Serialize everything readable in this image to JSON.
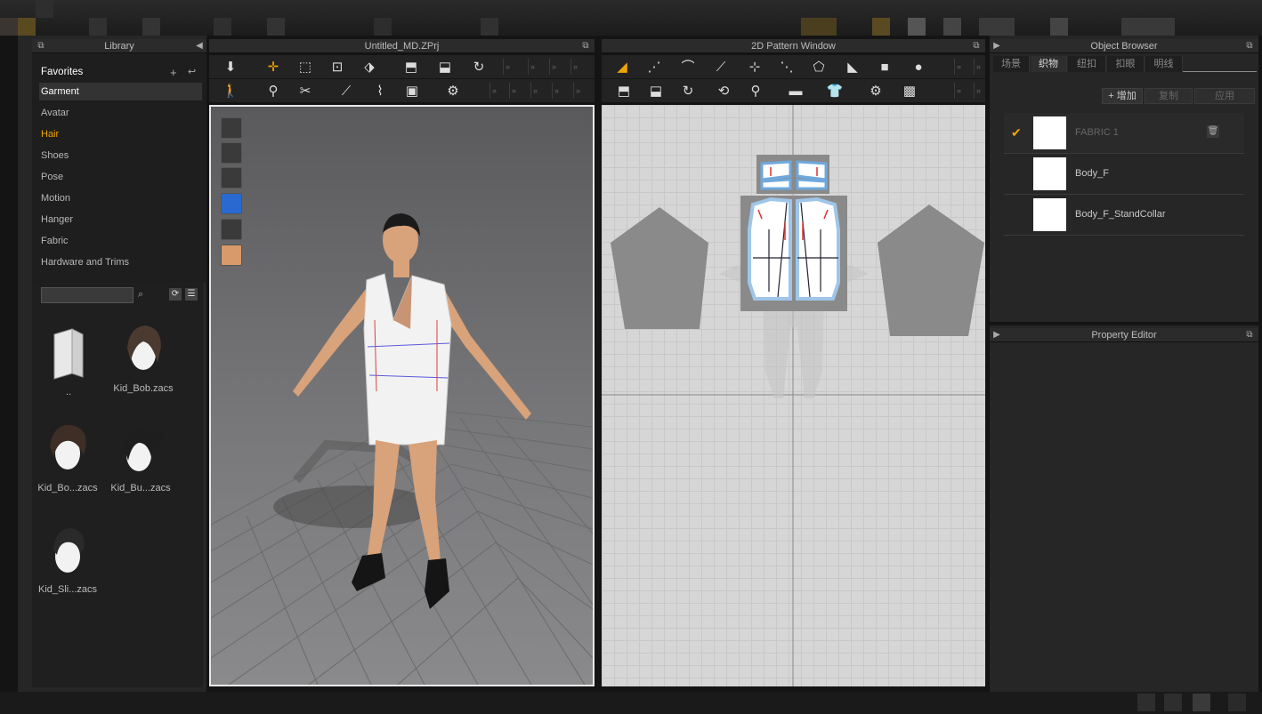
{
  "library": {
    "title": "Library",
    "categories": [
      "Favorites",
      "Garment",
      "Avatar",
      "Hair",
      "Shoes",
      "Pose",
      "Motion",
      "Hanger",
      "Fabric",
      "Hardware and Trims"
    ],
    "search": {
      "value": "",
      "placeholder": ""
    },
    "files": [
      "..",
      "Kid_Bob.zacs",
      "Kid_Bo...zacs",
      "Kid_Bu...zacs",
      "Kid_Sli...zacs"
    ]
  },
  "viewport3d": {
    "title": "Untitled_MD.ZPrj"
  },
  "pattern2d": {
    "title": "2D Pattern Window"
  },
  "object_browser": {
    "title": "Object Browser",
    "tabs": [
      "场景",
      "织物",
      "纽扣",
      "扣眼",
      "明线"
    ],
    "buttons": {
      "add": "+ 增加",
      "copy": "复制",
      "apply": "应用"
    },
    "fabrics": [
      "FABRIC 1",
      "Body_F",
      "Body_F_StandCollar"
    ]
  },
  "property_editor": {
    "title": "Property Editor"
  },
  "colors": {
    "accent": "#f0a400",
    "selected_text": "#ffffff",
    "bg": "#262626"
  }
}
